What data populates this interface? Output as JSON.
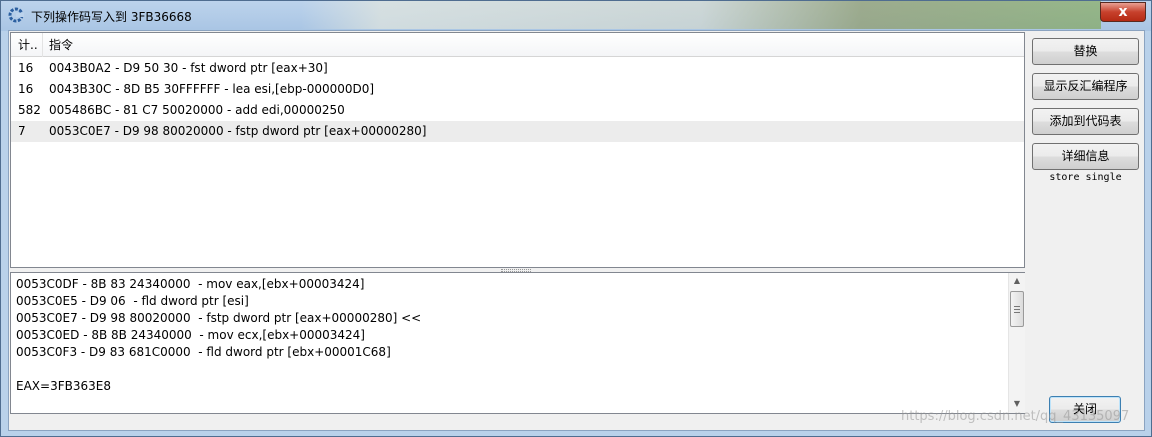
{
  "window": {
    "title": "下列操作码写入到 3FB36668",
    "close_glyph": "x"
  },
  "list": {
    "columns": [
      "计..",
      "指令"
    ],
    "rows": [
      {
        "count": "16",
        "instruction": "0043B0A2 - D9 50 30  - fst dword ptr [eax+30]"
      },
      {
        "count": "16",
        "instruction": "0043B30C - 8D B5 30FFFFFF  - lea esi,[ebp-000000D0]"
      },
      {
        "count": "582",
        "instruction": "005486BC - 81 C7 50020000 - add edi,00000250"
      },
      {
        "count": "7",
        "instruction": "0053C0E7 - D9 98 80020000  - fstp dword ptr [eax+00000280]"
      }
    ]
  },
  "disasm": {
    "lines": [
      "0053C0DF - 8B 83 24340000  - mov eax,[ebx+00003424]",
      "0053C0E5 - D9 06  - fld dword ptr [esi]",
      "0053C0E7 - D9 98 80020000  - fstp dword ptr [eax+00000280] <<",
      "0053C0ED - 8B 8B 24340000  - mov ecx,[ebx+00003424]",
      "0053C0F3 - D9 83 681C0000  - fld dword ptr [ebx+00001C68]",
      "",
      "EAX=3FB363E8"
    ]
  },
  "buttons": {
    "replace": "替换",
    "show_disassembler": "显示反汇编程序",
    "add_to_codelist": "添加到代码表",
    "more_info": "详细信息",
    "close": "关闭"
  },
  "store_label": "store single",
  "watermark": "https://blog.csdn.net/qq_43135097",
  "colors": {
    "title_bar": "#bcd3ec",
    "selected_row": "#ececec",
    "close_button": "#c7412c"
  }
}
